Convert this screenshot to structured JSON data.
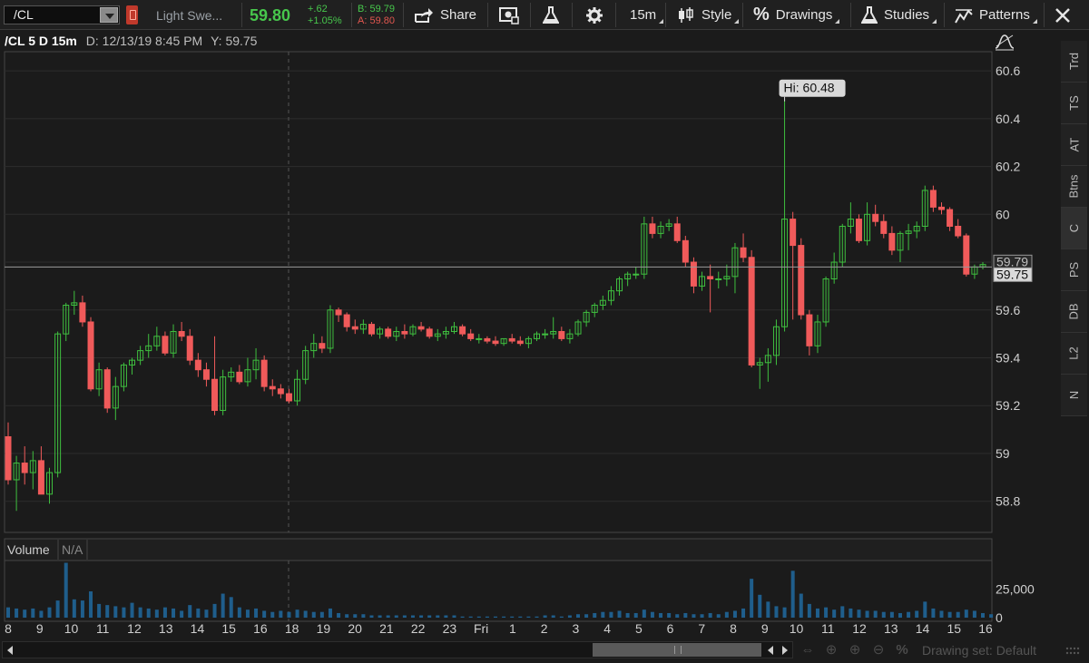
{
  "toolbar": {
    "symbol": "/CL",
    "description": "Light Swe...",
    "last_price": "59.80",
    "net_change": "+.62",
    "pct_change": "+1.05%",
    "bid": "B: 59.79",
    "ask": "A: 59.80",
    "share_label": "Share",
    "timeframe_label": "15m",
    "style_label": "Style",
    "drawings_label": "Drawings",
    "studies_label": "Studies",
    "patterns_label": "Patterns"
  },
  "chart_header": {
    "title": "/CL 5 D 15m",
    "date_label": "D: 12/13/19 8:45 PM",
    "y_label": "Y: 59.75"
  },
  "right_tabs": [
    "Trd",
    "TS",
    "AT",
    "Btns",
    "C",
    "PS",
    "DB",
    "L2",
    "N"
  ],
  "volume_pane": {
    "label": "Volume",
    "value": "N/A"
  },
  "bottom": {
    "drawing_set": "Drawing set: Default"
  },
  "colors": {
    "up": "#3fbf3f",
    "down": "#f05a5a",
    "volume": "#1f5e8c",
    "grid": "#2c2c2c",
    "background": "#1b1b1b"
  },
  "chart_data": {
    "type": "candlestick",
    "title": "/CL 5 D 15m",
    "ylim": [
      58.67,
      60.68
    ],
    "y_ticks": [
      "60.6",
      "60.4",
      "60.2",
      "60",
      "59.8",
      "59.6",
      "59.4",
      "59.2",
      "59",
      "58.8"
    ],
    "y_tick_values": [
      60.6,
      60.4,
      60.2,
      60.0,
      59.8,
      59.6,
      59.4,
      59.2,
      59.0,
      58.8
    ],
    "x_ticks": [
      "8",
      "9",
      "10",
      "11",
      "12",
      "13",
      "14",
      "15",
      "16",
      "18",
      "19",
      "20",
      "21",
      "22",
      "23",
      "Fri",
      "1",
      "2",
      "3",
      "4",
      "5",
      "6",
      "7",
      "8",
      "9",
      "10",
      "11",
      "12",
      "13",
      "14",
      "15",
      "16"
    ],
    "last_price_line": 59.78,
    "price_labels": [
      "59.79",
      "59.75"
    ],
    "annotation": "Hi: 60.48",
    "annotation_value": 60.48,
    "candles": [
      [
        59.07,
        59.13,
        58.87,
        58.89
      ],
      [
        58.89,
        58.99,
        58.76,
        58.96
      ],
      [
        58.96,
        59.03,
        58.87,
        58.92
      ],
      [
        58.92,
        59.01,
        58.85,
        58.97
      ],
      [
        58.97,
        59.03,
        58.84,
        58.83
      ],
      [
        58.83,
        58.94,
        58.79,
        58.92
      ],
      [
        58.92,
        59.51,
        58.9,
        59.5
      ],
      [
        59.5,
        59.63,
        59.47,
        59.62
      ],
      [
        59.62,
        59.68,
        59.58,
        59.63
      ],
      [
        59.63,
        59.66,
        59.53,
        59.55
      ],
      [
        59.55,
        59.57,
        59.26,
        59.27
      ],
      [
        59.27,
        59.38,
        59.24,
        59.35
      ],
      [
        59.35,
        59.36,
        59.17,
        59.19
      ],
      [
        59.19,
        59.32,
        59.14,
        59.28
      ],
      [
        59.28,
        59.38,
        59.26,
        59.37
      ],
      [
        59.37,
        59.4,
        59.33,
        59.39
      ],
      [
        59.39,
        59.45,
        59.37,
        59.43
      ],
      [
        59.43,
        59.5,
        59.4,
        59.45
      ],
      [
        59.45,
        59.53,
        59.43,
        59.49
      ],
      [
        59.49,
        59.51,
        59.41,
        59.42
      ],
      [
        59.42,
        59.54,
        59.4,
        59.51
      ],
      [
        59.51,
        59.55,
        59.47,
        59.49
      ],
      [
        59.49,
        59.52,
        59.37,
        59.39
      ],
      [
        59.39,
        59.42,
        59.32,
        59.35
      ],
      [
        59.35,
        59.38,
        59.28,
        59.31
      ],
      [
        59.31,
        59.49,
        59.16,
        59.18
      ],
      [
        59.18,
        59.35,
        59.16,
        59.32
      ],
      [
        59.32,
        59.36,
        59.3,
        59.34
      ],
      [
        59.34,
        59.37,
        59.29,
        59.3
      ],
      [
        59.3,
        59.4,
        59.28,
        59.35
      ],
      [
        59.35,
        59.44,
        59.31,
        59.39
      ],
      [
        59.39,
        59.41,
        59.26,
        59.28
      ],
      [
        59.28,
        59.31,
        59.24,
        59.27
      ],
      [
        59.27,
        59.29,
        59.23,
        59.25
      ],
      [
        59.25,
        59.27,
        59.21,
        59.22
      ],
      [
        59.22,
        59.35,
        59.2,
        59.31
      ],
      [
        59.31,
        59.45,
        59.29,
        59.43
      ],
      [
        59.43,
        59.5,
        59.4,
        59.46
      ],
      [
        59.46,
        59.49,
        59.42,
        59.44
      ],
      [
        59.44,
        59.62,
        59.42,
        59.6
      ],
      [
        59.6,
        59.61,
        59.55,
        59.58
      ],
      [
        59.58,
        59.59,
        59.51,
        59.53
      ],
      [
        59.53,
        59.56,
        59.5,
        59.52
      ],
      [
        59.52,
        59.56,
        59.5,
        59.54
      ],
      [
        59.54,
        59.55,
        59.49,
        59.5
      ],
      [
        59.5,
        59.53,
        59.48,
        59.52
      ],
      [
        59.52,
        59.53,
        59.48,
        59.49
      ],
      [
        59.49,
        59.53,
        59.47,
        59.51
      ],
      [
        59.51,
        59.54,
        59.48,
        59.5
      ],
      [
        59.5,
        59.54,
        59.49,
        59.53
      ],
      [
        59.53,
        59.55,
        59.51,
        59.52
      ],
      [
        59.52,
        59.53,
        59.48,
        59.49
      ],
      [
        59.49,
        59.52,
        59.47,
        59.5
      ],
      [
        59.5,
        59.53,
        59.48,
        59.51
      ],
      [
        59.51,
        59.55,
        59.5,
        59.53
      ],
      [
        59.53,
        59.54,
        59.49,
        59.5
      ],
      [
        59.5,
        59.52,
        59.47,
        59.48
      ],
      [
        59.48,
        59.5,
        59.46,
        59.48
      ],
      [
        59.48,
        59.49,
        59.46,
        59.47
      ],
      [
        59.47,
        59.49,
        59.45,
        59.46
      ],
      [
        59.46,
        59.48,
        59.45,
        59.48
      ],
      [
        59.48,
        59.5,
        59.46,
        59.47
      ],
      [
        59.47,
        59.49,
        59.45,
        59.46
      ],
      [
        59.46,
        59.49,
        59.44,
        59.48
      ],
      [
        59.48,
        59.51,
        59.47,
        59.5
      ],
      [
        59.5,
        59.52,
        59.48,
        59.5
      ],
      [
        59.5,
        59.57,
        59.48,
        59.51
      ],
      [
        59.51,
        59.53,
        59.47,
        59.48
      ],
      [
        59.48,
        59.52,
        59.46,
        59.5
      ],
      [
        59.5,
        59.56,
        59.49,
        59.55
      ],
      [
        59.55,
        59.6,
        59.53,
        59.59
      ],
      [
        59.59,
        59.63,
        59.57,
        59.62
      ],
      [
        59.62,
        59.66,
        59.6,
        59.64
      ],
      [
        59.64,
        59.7,
        59.62,
        59.68
      ],
      [
        59.68,
        59.74,
        59.66,
        59.73
      ],
      [
        59.73,
        59.76,
        59.7,
        59.75
      ],
      [
        59.75,
        59.78,
        59.73,
        59.75
      ],
      [
        59.75,
        59.99,
        59.73,
        59.96
      ],
      [
        59.96,
        59.99,
        59.9,
        59.92
      ],
      [
        59.92,
        59.97,
        59.9,
        59.95
      ],
      [
        59.95,
        59.98,
        59.93,
        59.96
      ],
      [
        59.96,
        59.99,
        59.88,
        59.89
      ],
      [
        59.89,
        59.91,
        59.78,
        59.8
      ],
      [
        59.8,
        59.82,
        59.67,
        59.7
      ],
      [
        59.7,
        59.76,
        59.68,
        59.74
      ],
      [
        59.74,
        59.79,
        59.59,
        59.73
      ],
      [
        59.73,
        59.76,
        59.69,
        59.73
      ],
      [
        59.73,
        59.79,
        59.7,
        59.74
      ],
      [
        59.74,
        59.88,
        59.67,
        59.86
      ],
      [
        59.86,
        59.92,
        59.8,
        59.82
      ],
      [
        59.82,
        59.85,
        59.36,
        59.37
      ],
      [
        59.37,
        59.4,
        59.27,
        59.38
      ],
      [
        59.38,
        59.44,
        59.3,
        59.41
      ],
      [
        59.41,
        59.56,
        59.37,
        59.53
      ],
      [
        59.53,
        60.48,
        59.51,
        59.98
      ],
      [
        59.98,
        60.01,
        59.56,
        59.87
      ],
      [
        59.87,
        59.9,
        59.56,
        59.58
      ],
      [
        59.58,
        59.6,
        59.41,
        59.45
      ],
      [
        59.45,
        59.58,
        59.42,
        59.55
      ],
      [
        59.55,
        59.74,
        59.53,
        59.73
      ],
      [
        59.73,
        59.84,
        59.71,
        59.8
      ],
      [
        59.8,
        59.96,
        59.78,
        59.95
      ],
      [
        59.95,
        60.05,
        59.92,
        59.98
      ],
      [
        59.98,
        60.0,
        59.88,
        59.89
      ],
      [
        59.89,
        60.05,
        59.87,
        60.0
      ],
      [
        60.0,
        60.04,
        59.95,
        59.97
      ],
      [
        59.97,
        60.0,
        59.9,
        59.92
      ],
      [
        59.92,
        59.95,
        59.83,
        59.85
      ],
      [
        59.85,
        59.93,
        59.8,
        59.92
      ],
      [
        59.92,
        59.96,
        59.85,
        59.93
      ],
      [
        59.93,
        59.97,
        59.9,
        59.95
      ],
      [
        59.95,
        60.12,
        59.93,
        60.1
      ],
      [
        60.1,
        60.12,
        60.01,
        60.03
      ],
      [
        60.03,
        60.05,
        60.0,
        60.02
      ],
      [
        60.02,
        60.03,
        59.93,
        59.95
      ],
      [
        59.95,
        59.98,
        59.9,
        59.91
      ],
      [
        59.91,
        59.92,
        59.74,
        59.75
      ],
      [
        59.75,
        59.79,
        59.73,
        59.78
      ],
      [
        59.78,
        59.8,
        59.77,
        59.79
      ]
    ],
    "volume_ylim": [
      0,
      50000
    ],
    "volume_ticks": [
      "25,000",
      "0"
    ],
    "volume_tick_values": [
      25000,
      0
    ],
    "volume": [
      9000,
      8000,
      7000,
      8000,
      6000,
      9000,
      15000,
      48000,
      16000,
      15000,
      23000,
      12000,
      11000,
      10000,
      9000,
      13000,
      9000,
      8000,
      7000,
      9000,
      8000,
      6000,
      11000,
      8000,
      7000,
      12000,
      21000,
      18000,
      9000,
      7000,
      8000,
      6000,
      5000,
      6000,
      5000,
      7000,
      6000,
      5000,
      5000,
      8000,
      4000,
      3000,
      3000,
      3000,
      2000,
      2000,
      2000,
      2000,
      2000,
      2000,
      2000,
      2000,
      2000,
      2000,
      2000,
      1000,
      1000,
      1000,
      1000,
      1000,
      1000,
      1000,
      1000,
      1000,
      1000,
      2000,
      2000,
      1000,
      2000,
      3000,
      3000,
      4000,
      5000,
      5000,
      6000,
      4000,
      4000,
      7000,
      5000,
      4000,
      4000,
      3000,
      4000,
      3000,
      3000,
      4000,
      3000,
      5000,
      6000,
      8000,
      34000,
      20000,
      14000,
      10000,
      9000,
      41000,
      21000,
      12000,
      8000,
      9000,
      7000,
      10000,
      8000,
      7000,
      6000,
      6000,
      5000,
      5000,
      4000,
      5000,
      6000,
      14000,
      8000,
      6000,
      5000,
      5000,
      7000,
      6000,
      4000,
      3000
    ]
  }
}
